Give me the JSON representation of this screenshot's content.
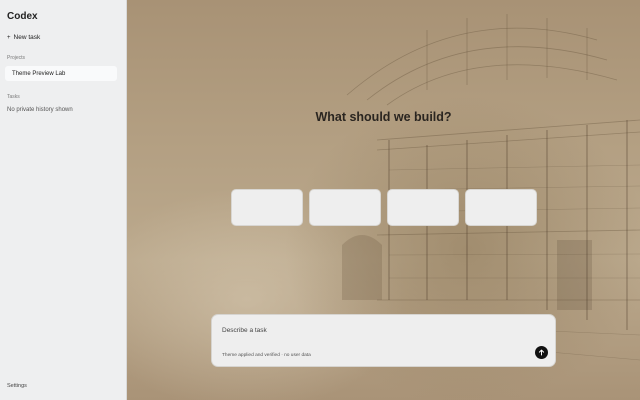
{
  "sidebar": {
    "app_name": "Codex",
    "new_task_label": "New task",
    "projects_label": "Projects",
    "projects": [
      {
        "label": "Theme Preview Lab"
      }
    ],
    "tasks_label": "Tasks",
    "tasks_empty": "No private history shown",
    "settings_label": "Settings"
  },
  "main": {
    "headline": "What should we build?",
    "cards_count": 4,
    "composer": {
      "placeholder": "Describe a task",
      "status": "Theme applied and verified · no user data",
      "send_icon": "arrow-up-icon"
    }
  },
  "colors": {
    "sidebar_bg": "#eeeff0",
    "background_tone": "#b39f82",
    "send_button": "#111111"
  }
}
